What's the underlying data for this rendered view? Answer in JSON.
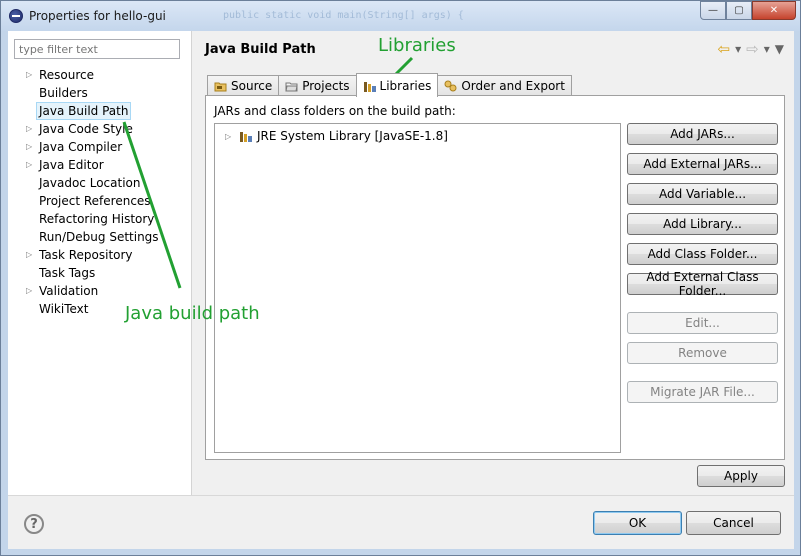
{
  "window": {
    "title": "Properties for hello-gui",
    "ghost_code": "public static void main(String[] args) {",
    "minimize_glyph": "—",
    "maximize_glyph": "▢",
    "close_glyph": "✕"
  },
  "filter": {
    "placeholder": "type filter text"
  },
  "tree": [
    {
      "label": "Resource",
      "expandable": true
    },
    {
      "label": "Builders",
      "expandable": false
    },
    {
      "label": "Java Build Path",
      "expandable": false,
      "selected": true
    },
    {
      "label": "Java Code Style",
      "expandable": true
    },
    {
      "label": "Java Compiler",
      "expandable": true
    },
    {
      "label": "Java Editor",
      "expandable": true
    },
    {
      "label": "Javadoc Location",
      "expandable": false
    },
    {
      "label": "Project References",
      "expandable": false
    },
    {
      "label": "Refactoring History",
      "expandable": false
    },
    {
      "label": "Run/Debug Settings",
      "expandable": false
    },
    {
      "label": "Task Repository",
      "expandable": true
    },
    {
      "label": "Task Tags",
      "expandable": false
    },
    {
      "label": "Validation",
      "expandable": true
    },
    {
      "label": "WikiText",
      "expandable": false
    }
  ],
  "page": {
    "title": "Java Build Path"
  },
  "nav": {
    "back": "⇦",
    "forward": "⇨",
    "dropdown": "▾",
    "menu": "▼"
  },
  "tabs": [
    {
      "label": "Source",
      "icon": "source-folder-icon"
    },
    {
      "label": "Projects",
      "icon": "projects-folder-icon"
    },
    {
      "label": "Libraries",
      "icon": "libraries-icon",
      "active": true
    },
    {
      "label": "Order and Export",
      "icon": "order-export-icon"
    }
  ],
  "libraries": {
    "heading": "JARs and class folders on the build path:",
    "entries": [
      {
        "label": "JRE System Library [JavaSE-1.8]"
      }
    ],
    "buttons": [
      {
        "label": "Add JARs...",
        "enabled": true
      },
      {
        "label": "Add External JARs...",
        "enabled": true
      },
      {
        "label": "Add Variable...",
        "enabled": true
      },
      {
        "label": "Add Library...",
        "enabled": true
      },
      {
        "label": "Add Class Folder...",
        "enabled": true
      },
      {
        "label": "Add External Class Folder...",
        "enabled": true
      },
      {
        "label": "Edit...",
        "enabled": false
      },
      {
        "label": "Remove",
        "enabled": false
      },
      {
        "label": "Migrate JAR File...",
        "enabled": false
      }
    ]
  },
  "actions": {
    "apply": "Apply",
    "ok": "OK",
    "cancel": "Cancel",
    "help": "?"
  },
  "annotations": {
    "libraries": "Libraries",
    "java_build_path": "Java build path"
  },
  "colors": {
    "annotation": "#22a032",
    "selection_bg": "#e5f3fb",
    "titlebar": "#c4d6ec"
  }
}
